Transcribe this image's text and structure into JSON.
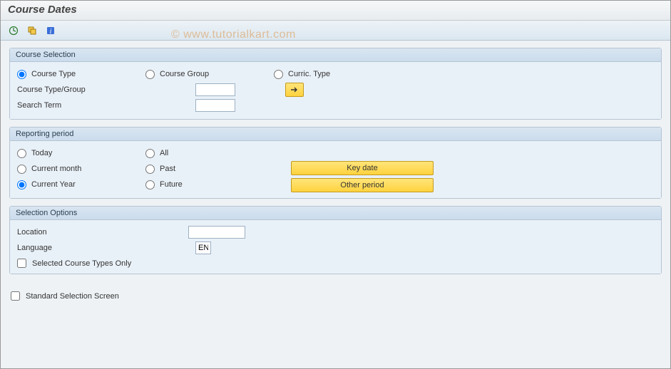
{
  "window": {
    "title": "Course Dates"
  },
  "watermark": "© www.tutorialkart.com",
  "courseSelection": {
    "title": "Course Selection",
    "radios": {
      "courseType": "Course Type",
      "courseGroup": "Course Group",
      "curricType": "Curric. Type",
      "selected": "courseType"
    },
    "courseTypeGroupLabel": "Course Type/Group",
    "courseTypeGroupValue": "",
    "searchTermLabel": "Search Term",
    "searchTermValue": ""
  },
  "reportingPeriod": {
    "title": "Reporting period",
    "radios": {
      "today": "Today",
      "currentMonth": "Current month",
      "currentYear": "Current Year",
      "all": "All",
      "past": "Past",
      "future": "Future",
      "selected": "currentYear"
    },
    "keyDateBtn": "Key date",
    "otherPeriodBtn": "Other period"
  },
  "selectionOptions": {
    "title": "Selection Options",
    "locationLabel": "Location",
    "locationValue": "",
    "languageLabel": "Language",
    "languageValue": "EN",
    "selectedCourseTypesOnlyLabel": "Selected Course Types Only",
    "selectedCourseTypesOnlyChecked": false
  },
  "standardSelectionScreen": {
    "label": "Standard Selection Screen",
    "checked": false
  }
}
